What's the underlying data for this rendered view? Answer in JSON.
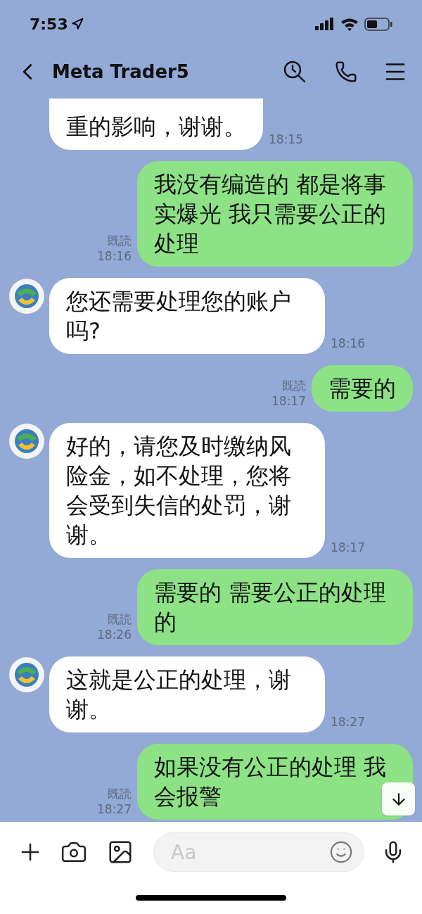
{
  "status_bar": {
    "time": "7:53"
  },
  "header": {
    "title": "Meta Trader5"
  },
  "messages": [
    {
      "kind": "incoming",
      "partial": true,
      "text": "重的影响，谢谢。",
      "time": "18:15"
    },
    {
      "kind": "outgoing",
      "partial": false,
      "text": "我没有编造的 都是将事实爆光 我只需要公正的处理",
      "read_label": "既読",
      "time": "18:16"
    },
    {
      "kind": "incoming",
      "partial": false,
      "text": "您还需要处理您的账户吗?",
      "time": "18:16"
    },
    {
      "kind": "outgoing",
      "partial": false,
      "text": "需要的",
      "read_label": "既読",
      "time": "18:17"
    },
    {
      "kind": "incoming",
      "partial": false,
      "text": "好的，请您及时缴纳风险金，如不处理，您将会受到失信的处罚，谢谢。",
      "time": "18:17"
    },
    {
      "kind": "outgoing",
      "partial": false,
      "text": "需要的 需要公正的处理的",
      "read_label": "既読",
      "time": "18:26"
    },
    {
      "kind": "incoming",
      "partial": false,
      "text": "这就是公正的处理，谢谢。",
      "time": "18:27"
    },
    {
      "kind": "outgoing",
      "partial": false,
      "text": "如果没有公正的处理 我会报警",
      "read_label": "既読",
      "time": "18:27"
    }
  ],
  "composer": {
    "placeholder": "Aa"
  }
}
